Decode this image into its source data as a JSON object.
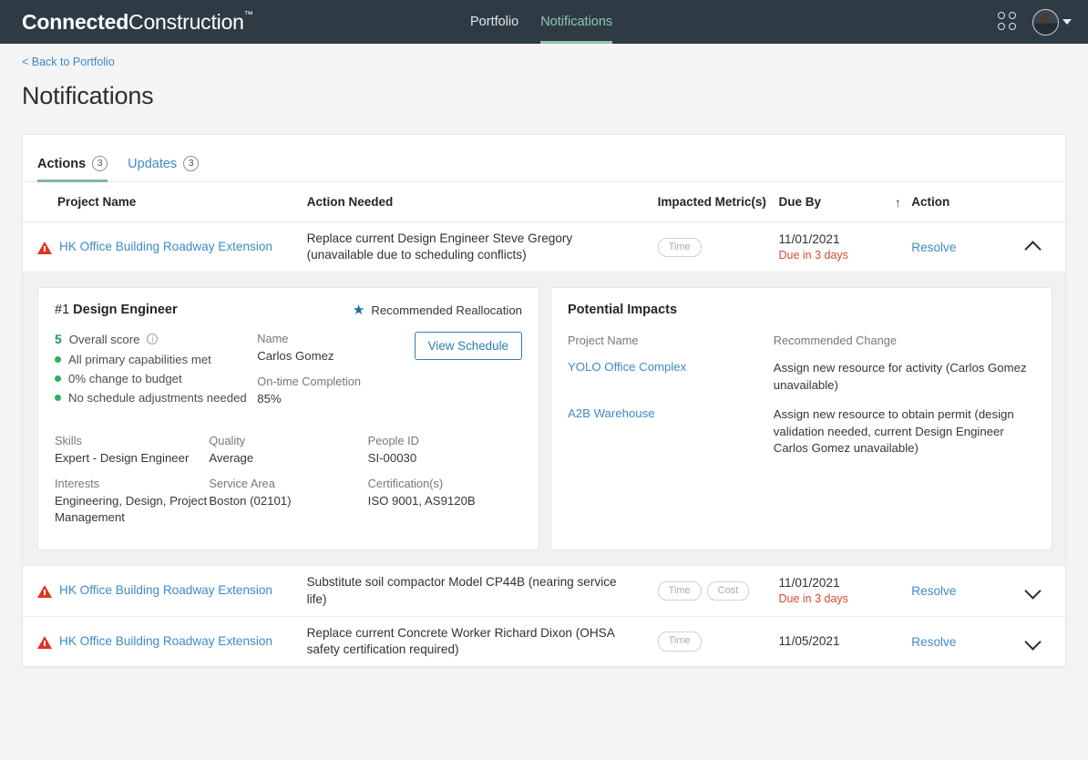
{
  "topbar": {
    "brand_bold": "Connected",
    "brand_light": "Construction",
    "brand_tm": "™",
    "nav": [
      {
        "label": "Portfolio",
        "active": false
      },
      {
        "label": "Notifications",
        "active": true
      }
    ],
    "apps_icon": "grid-apps-icon",
    "avatar_icon": "user-avatar",
    "caret_icon": "chevron-down-icon"
  },
  "page": {
    "back_link": "< Back to Portfolio",
    "title": "Notifications"
  },
  "tabs": [
    {
      "label": "Actions",
      "count": "3",
      "active": true
    },
    {
      "label": "Updates",
      "count": "3",
      "active": false
    }
  ],
  "table": {
    "headers": {
      "project": "Project Name",
      "action": "Action Needed",
      "metric": "Impacted Metric(s)",
      "due": "Due By",
      "sort": "↑",
      "resolve": "Action"
    },
    "rows": [
      {
        "project": "HK Office Building Roadway Extension",
        "action": "Replace current Design Engineer Steve Gregory (unavailable due to scheduling conflicts)",
        "metrics": [
          "Time"
        ],
        "due_date": "11/01/2021",
        "due_warning": "Due in 3 days",
        "resolve": "Resolve",
        "expanded": true
      },
      {
        "project": "HK Office Building Roadway Extension",
        "action": "Substitute soil compactor Model CP44B (nearing service life)",
        "metrics": [
          "Time",
          "Cost"
        ],
        "due_date": "11/01/2021",
        "due_warning": "Due in 3 days",
        "resolve": "Resolve",
        "expanded": false
      },
      {
        "project": "HK Office Building Roadway Extension",
        "action": "Replace current Concrete Worker Richard Dixon (OHSA safety certification required)",
        "metrics": [
          "Time"
        ],
        "due_date": "11/05/2021",
        "due_warning": "",
        "resolve": "Resolve",
        "expanded": false
      }
    ]
  },
  "detail": {
    "rank": "#1",
    "role": "Design Engineer",
    "recommended_label": "Recommended Reallocation",
    "score_value": "5",
    "score_label": "Overall score",
    "score_info_icon": "info-icon",
    "bullets": [
      "All primary capabilities met",
      "0% change to budget",
      "No schedule adjustments needed"
    ],
    "name_label": "Name",
    "name_value": "Carlos Gomez",
    "completion_label": "On-time Completion",
    "completion_value": "85%",
    "view_schedule": "View Schedule",
    "fields": {
      "skills_label": "Skills",
      "skills_value": "Expert - Design Engineer",
      "quality_label": "Quality",
      "quality_value": "Average",
      "people_label": "People ID",
      "people_value": "SI-00030",
      "interests_label": "Interests",
      "interests_value": "Engineering, Design, Project Management",
      "service_label": "Service Area",
      "service_value": "Boston (02101)",
      "cert_label": "Certification(s)",
      "cert_value": "ISO 9001, AS9120B"
    },
    "impacts": {
      "title": "Potential Impacts",
      "col_name": "Project Name",
      "col_change": "Recommended Change",
      "rows": [
        {
          "name": "YOLO Office Complex",
          "change": "Assign new resource for activity (Carlos Gomez unavailable)"
        },
        {
          "name": "A2B Warehouse",
          "change": "Assign new resource to obtain permit (design validation needed, current Design Engineer Carlos Gomez unavailable)"
        }
      ]
    }
  },
  "colors": {
    "topbar_bg": "#2e3b45",
    "accent_green": "#8fc7ad",
    "link_blue": "#3d8bc4",
    "warn_red": "#e03426",
    "due_red": "#d94a32",
    "score_green": "#1f9b54",
    "star_blue": "#1a6fa8",
    "page_bg": "#f4f4f5"
  }
}
